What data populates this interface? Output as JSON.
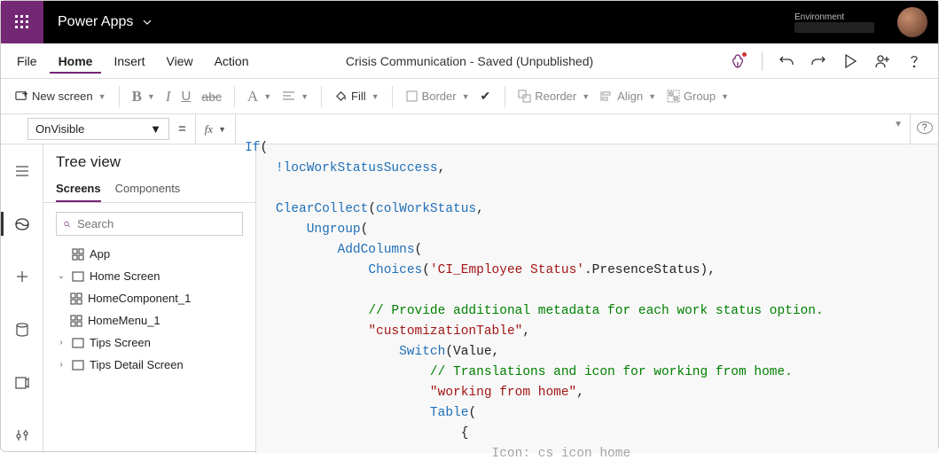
{
  "topbar": {
    "app_name": "Power Apps",
    "env_label": "Environment"
  },
  "menus": {
    "file": "File",
    "home": "Home",
    "insert": "Insert",
    "view": "View",
    "action": "Action"
  },
  "doc_title": "Crisis Communication - Saved (Unpublished)",
  "toolbar": {
    "new_screen": "New screen",
    "fill": "Fill",
    "border": "Border",
    "reorder": "Reorder",
    "align": "Align",
    "group": "Group",
    "font_letter": "A"
  },
  "property_selector": "OnVisible",
  "fx_label": "fx",
  "tree": {
    "title": "Tree view",
    "tabs": {
      "screens": "Screens",
      "components": "Components"
    },
    "search_placeholder": "Search",
    "items": {
      "app": "App",
      "home_screen": "Home Screen",
      "home_component": "HomeComponent_1",
      "home_menu": "HomeMenu_1",
      "tips_screen": "Tips Screen",
      "tips_detail": "Tips Detail Screen"
    }
  },
  "code": {
    "l1a": "If",
    "l1b": "(",
    "l2a": "!",
    "l2b": "locWorkStatusSuccess",
    "l2c": ",",
    "l3a": "ClearCollect",
    "l3b": "(",
    "l3c": "colWorkStatus",
    "l3d": ",",
    "l4a": "Ungroup",
    "l4b": "(",
    "l5a": "AddColumns",
    "l5b": "(",
    "l6a": "Choices",
    "l6b": "(",
    "l6c": "'CI_Employee Status'",
    "l6d": ".PresenceStatus),",
    "l7": "// Provide additional metadata for each work status option.",
    "l8": "\"customizationTable\"",
    "l8b": ",",
    "l9a": "Switch",
    "l9b": "(Value,",
    "l10": "// Translations and icon for working from home.",
    "l11": "\"working from home\"",
    "l11b": ",",
    "l12a": "Table",
    "l12b": "(",
    "l13": "{",
    "l14": "Icon: cs icon home"
  }
}
